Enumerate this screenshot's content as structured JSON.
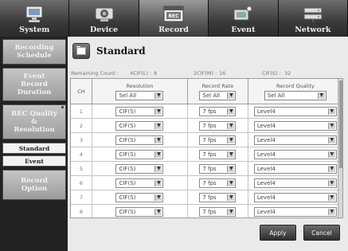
{
  "nav": {
    "tabs": [
      {
        "label": "System",
        "icon": "system-icon"
      },
      {
        "label": "Device",
        "icon": "device-icon"
      },
      {
        "label": "Record",
        "icon": "record-icon",
        "active": true
      },
      {
        "label": "Event",
        "icon": "event-icon"
      },
      {
        "label": "Network",
        "icon": "network-icon"
      }
    ],
    "record_icon_text": "REC"
  },
  "sidebar": {
    "items": [
      {
        "label": "Recording\nSchedule"
      },
      {
        "label": "Event\nRecord\nDuration"
      },
      {
        "label": "REC Quality\n&\nResolution",
        "active": true
      },
      {
        "label": "Record\nOption"
      }
    ],
    "subitems": [
      {
        "label": "Standard",
        "selected": true
      },
      {
        "label": "Event"
      }
    ]
  },
  "page": {
    "title": "Standard"
  },
  "remaining": {
    "label": "Remaining Count :",
    "values": [
      {
        "label": "4CIF(L) :",
        "value": "8"
      },
      {
        "label": "2CIF(M) :",
        "value": "16"
      },
      {
        "label": "CIF(S) :",
        "value": "32"
      }
    ]
  },
  "table": {
    "headers": {
      "ch": "CH",
      "resolution": "Resolution",
      "rate": "Record Rate",
      "quality": "Record Quality"
    },
    "select_all": {
      "resolution": "Sel All",
      "rate": "Sel All",
      "quality": "Sel All"
    },
    "rows": [
      {
        "ch": "1",
        "resolution": "CIF(S)",
        "rate": "7 fps",
        "quality": "Level4"
      },
      {
        "ch": "2",
        "resolution": "CIF(S)",
        "rate": "7 fps",
        "quality": "Level4"
      },
      {
        "ch": "3",
        "resolution": "CIF(S)",
        "rate": "7 fps",
        "quality": "Level4"
      },
      {
        "ch": "4",
        "resolution": "CIF(S)",
        "rate": "7 fps",
        "quality": "Level4"
      },
      {
        "ch": "5",
        "resolution": "CIF(S)",
        "rate": "7 fps",
        "quality": "Level4"
      },
      {
        "ch": "6",
        "resolution": "CIF(S)",
        "rate": "7 fps",
        "quality": "Level4"
      },
      {
        "ch": "7",
        "resolution": "CIF(S)",
        "rate": "7 fps",
        "quality": "Level4"
      },
      {
        "ch": "8",
        "resolution": "CIF(S)",
        "rate": "7 fps",
        "quality": "Level4"
      }
    ]
  },
  "buttons": {
    "apply": "Apply",
    "cancel": "Cancel"
  },
  "colors": {
    "background": "#1b1b1b",
    "panel": "#eaeaea",
    "button": "#3a3a3a"
  }
}
